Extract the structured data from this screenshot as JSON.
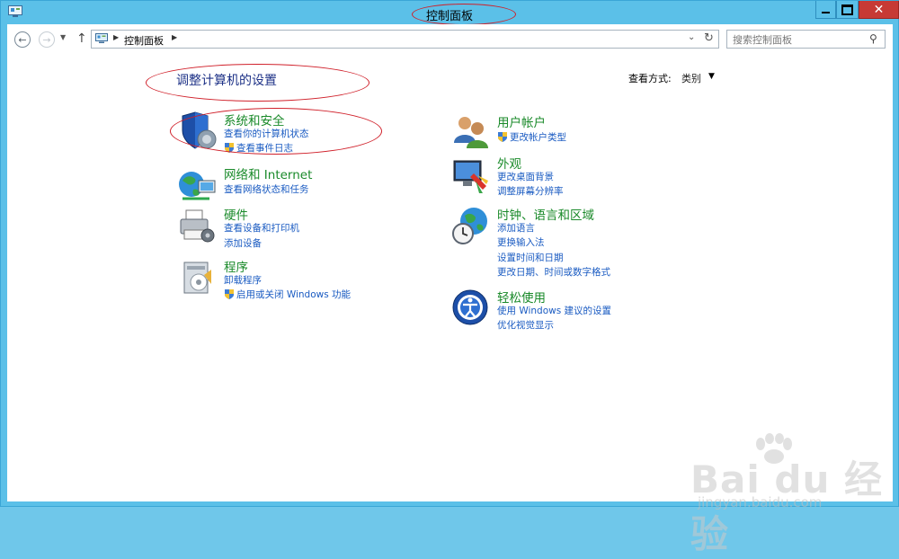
{
  "window": {
    "title": "控制面板",
    "buttons": {
      "minimize": "minimize-icon",
      "maximize": "maximize-icon",
      "close": "close-icon"
    }
  },
  "nav": {
    "breadcrumb": [
      "控制面板"
    ],
    "search_placeholder": "搜索控制面板"
  },
  "page": {
    "title": "调整计算机的设置",
    "view_by_label": "查看方式:",
    "view_by_value": "类别"
  },
  "categories": [
    {
      "title": "系统和安全",
      "icon": "shield-icon",
      "links": [
        {
          "text": "查看你的计算机状态",
          "shield": false
        },
        {
          "text": "查看事件日志",
          "shield": true
        }
      ]
    },
    {
      "title": "网络和 Internet",
      "icon": "network-icon",
      "links": [
        {
          "text": "查看网络状态和任务",
          "shield": false
        }
      ]
    },
    {
      "title": "硬件",
      "icon": "printer-icon",
      "links": [
        {
          "text": "查看设备和打印机",
          "shield": false
        },
        {
          "text": "添加设备",
          "shield": false
        }
      ]
    },
    {
      "title": "程序",
      "icon": "programs-icon",
      "links": [
        {
          "text": "卸载程序",
          "shield": false
        },
        {
          "text": "启用或关闭 Windows 功能",
          "shield": true
        }
      ]
    },
    {
      "title": "用户帐户",
      "icon": "users-icon",
      "links": [
        {
          "text": "更改帐户类型",
          "shield": true
        }
      ]
    },
    {
      "title": "外观",
      "icon": "appearance-icon",
      "links": [
        {
          "text": "更改桌面背景",
          "shield": false
        },
        {
          "text": "调整屏幕分辨率",
          "shield": false
        }
      ]
    },
    {
      "title": "时钟、语言和区域",
      "icon": "clock-globe-icon",
      "links": [
        {
          "text": "添加语言",
          "shield": false
        },
        {
          "text": "更换输入法",
          "shield": false
        },
        {
          "text": "设置时间和日期",
          "shield": false
        },
        {
          "text": "更改日期、时间或数字格式",
          "shield": false
        }
      ]
    },
    {
      "title": "轻松使用",
      "icon": "ease-of-access-icon",
      "links": [
        {
          "text": "使用 Windows 建议的设置",
          "shield": false
        },
        {
          "text": "优化视觉显示",
          "shield": false
        }
      ]
    }
  ],
  "watermark": {
    "text": "Bai du 经验",
    "sub": "jingyan.baidu.com"
  },
  "colors": {
    "title_bar": "#5bc0e8",
    "category_title": "#1a8a2a",
    "link": "#1a5bc2",
    "heading": "#1e3287",
    "annotation": "#d0202a"
  }
}
